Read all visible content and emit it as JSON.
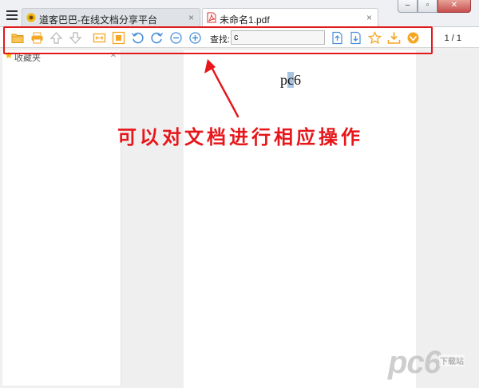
{
  "tabs": [
    {
      "label": "道客巴巴-在线文档分享平台",
      "icon": "doc88-logo-icon",
      "active": false
    },
    {
      "label": "未命名1.pdf",
      "icon": "pdf-file-icon",
      "active": true
    }
  ],
  "toolbar": {
    "buttons": [
      "open-folder-icon",
      "print-icon",
      "previous-page-icon",
      "next-page-icon",
      "fit-width-icon",
      "full-screen-icon",
      "rotate-left-icon",
      "rotate-right-icon",
      "zoom-out-icon",
      "zoom-in-icon",
      "find-previous-icon",
      "find-next-icon",
      "favorite-star-icon",
      "download-icon",
      "vip-icon"
    ],
    "search_label": "查找:",
    "search_value": "c",
    "page_indicator": "1 / 1"
  },
  "sidebar": {
    "title": "收藏夹"
  },
  "document": {
    "text_before": "p",
    "text_highlight": "c",
    "text_after": "6"
  },
  "annotation": {
    "caption": "可以对文档进行相应操作",
    "color": "#e6161a"
  },
  "watermark": {
    "logo": "pc6",
    "sub": "下载站"
  },
  "colors": {
    "toolbar_icon_orange": "#f5a623",
    "toolbar_icon_blue": "#4a90d9",
    "toolbar_icon_gray": "#b5b5b5",
    "highlight": "#a9c4df"
  }
}
